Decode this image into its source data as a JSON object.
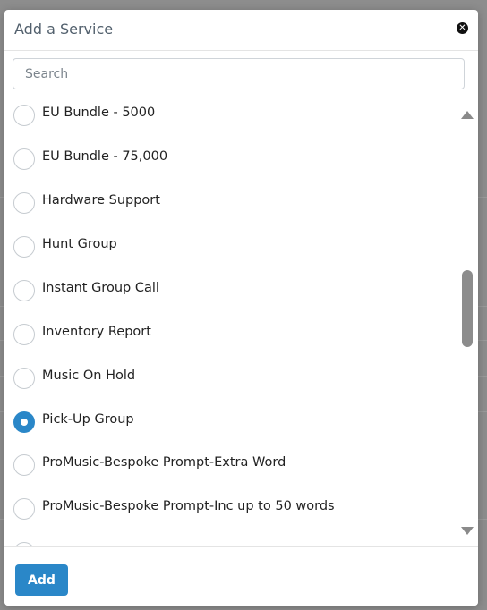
{
  "modal": {
    "title": "Add a Service",
    "close_icon": "close-icon",
    "search": {
      "placeholder": "Search",
      "value": ""
    },
    "services": [
      {
        "label": "EU Bundle - 5000",
        "selected": false
      },
      {
        "label": "EU Bundle - 75,000",
        "selected": false
      },
      {
        "label": "Hardware Support",
        "selected": false
      },
      {
        "label": "Hunt Group",
        "selected": false
      },
      {
        "label": "Instant Group Call",
        "selected": false
      },
      {
        "label": "Inventory Report",
        "selected": false
      },
      {
        "label": "Music On Hold",
        "selected": false
      },
      {
        "label": "Pick-Up Group",
        "selected": true
      },
      {
        "label": "ProMusic-Bespoke Prompt-Extra Word",
        "selected": false
      },
      {
        "label": "ProMusic-Bespoke Prompt-Inc up to 50 words",
        "selected": false
      }
    ],
    "add_button": "Add"
  },
  "colors": {
    "accent": "#2a87c8",
    "overlay": "#8d8d8d"
  }
}
